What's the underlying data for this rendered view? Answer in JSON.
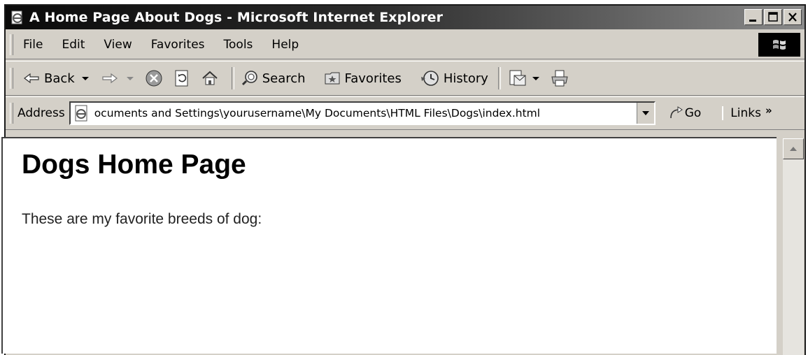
{
  "window": {
    "title": "A Home Page About Dogs - Microsoft Internet Explorer"
  },
  "menu": {
    "items": [
      "File",
      "Edit",
      "View",
      "Favorites",
      "Tools",
      "Help"
    ]
  },
  "toolbar": {
    "back_label": "Back",
    "search_label": "Search",
    "favorites_label": "Favorites",
    "history_label": "History"
  },
  "address": {
    "label": "Address",
    "value": "ocuments and Settings\\yourusername\\My Documents\\HTML Files\\Dogs\\index.html",
    "go_label": "Go",
    "links_label": "Links",
    "links_chevron": "»"
  },
  "page": {
    "heading": "Dogs Home Page",
    "paragraph": "These are my favorite breeds of dog:"
  },
  "icons": [
    "ie-page-icon",
    "minimize-icon",
    "maximize-icon",
    "close-icon",
    "windows-logo-icon",
    "back-arrow-icon",
    "forward-arrow-icon",
    "stop-icon",
    "refresh-icon",
    "home-icon",
    "search-icon",
    "favorites-icon",
    "history-icon",
    "mail-icon",
    "print-icon",
    "go-arrow-icon",
    "scroll-up-icon"
  ]
}
